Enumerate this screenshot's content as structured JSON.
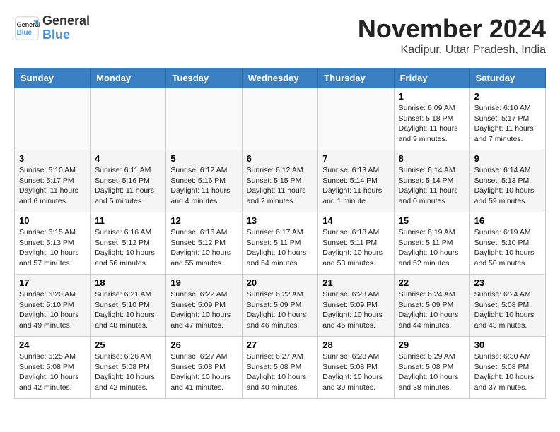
{
  "logo": {
    "general": "General",
    "blue": "Blue"
  },
  "title": "November 2024",
  "subtitle": "Kadipur, Uttar Pradesh, India",
  "days_of_week": [
    "Sunday",
    "Monday",
    "Tuesday",
    "Wednesday",
    "Thursday",
    "Friday",
    "Saturday"
  ],
  "weeks": [
    [
      {
        "day": "",
        "info": ""
      },
      {
        "day": "",
        "info": ""
      },
      {
        "day": "",
        "info": ""
      },
      {
        "day": "",
        "info": ""
      },
      {
        "day": "",
        "info": ""
      },
      {
        "day": "1",
        "info": "Sunrise: 6:09 AM\nSunset: 5:18 PM\nDaylight: 11 hours\nand 9 minutes."
      },
      {
        "day": "2",
        "info": "Sunrise: 6:10 AM\nSunset: 5:17 PM\nDaylight: 11 hours\nand 7 minutes."
      }
    ],
    [
      {
        "day": "3",
        "info": "Sunrise: 6:10 AM\nSunset: 5:17 PM\nDaylight: 11 hours\nand 6 minutes."
      },
      {
        "day": "4",
        "info": "Sunrise: 6:11 AM\nSunset: 5:16 PM\nDaylight: 11 hours\nand 5 minutes."
      },
      {
        "day": "5",
        "info": "Sunrise: 6:12 AM\nSunset: 5:16 PM\nDaylight: 11 hours\nand 4 minutes."
      },
      {
        "day": "6",
        "info": "Sunrise: 6:12 AM\nSunset: 5:15 PM\nDaylight: 11 hours\nand 2 minutes."
      },
      {
        "day": "7",
        "info": "Sunrise: 6:13 AM\nSunset: 5:14 PM\nDaylight: 11 hours\nand 1 minute."
      },
      {
        "day": "8",
        "info": "Sunrise: 6:14 AM\nSunset: 5:14 PM\nDaylight: 11 hours\nand 0 minutes."
      },
      {
        "day": "9",
        "info": "Sunrise: 6:14 AM\nSunset: 5:13 PM\nDaylight: 10 hours\nand 59 minutes."
      }
    ],
    [
      {
        "day": "10",
        "info": "Sunrise: 6:15 AM\nSunset: 5:13 PM\nDaylight: 10 hours\nand 57 minutes."
      },
      {
        "day": "11",
        "info": "Sunrise: 6:16 AM\nSunset: 5:12 PM\nDaylight: 10 hours\nand 56 minutes."
      },
      {
        "day": "12",
        "info": "Sunrise: 6:16 AM\nSunset: 5:12 PM\nDaylight: 10 hours\nand 55 minutes."
      },
      {
        "day": "13",
        "info": "Sunrise: 6:17 AM\nSunset: 5:11 PM\nDaylight: 10 hours\nand 54 minutes."
      },
      {
        "day": "14",
        "info": "Sunrise: 6:18 AM\nSunset: 5:11 PM\nDaylight: 10 hours\nand 53 minutes."
      },
      {
        "day": "15",
        "info": "Sunrise: 6:19 AM\nSunset: 5:11 PM\nDaylight: 10 hours\nand 52 minutes."
      },
      {
        "day": "16",
        "info": "Sunrise: 6:19 AM\nSunset: 5:10 PM\nDaylight: 10 hours\nand 50 minutes."
      }
    ],
    [
      {
        "day": "17",
        "info": "Sunrise: 6:20 AM\nSunset: 5:10 PM\nDaylight: 10 hours\nand 49 minutes."
      },
      {
        "day": "18",
        "info": "Sunrise: 6:21 AM\nSunset: 5:10 PM\nDaylight: 10 hours\nand 48 minutes."
      },
      {
        "day": "19",
        "info": "Sunrise: 6:22 AM\nSunset: 5:09 PM\nDaylight: 10 hours\nand 47 minutes."
      },
      {
        "day": "20",
        "info": "Sunrise: 6:22 AM\nSunset: 5:09 PM\nDaylight: 10 hours\nand 46 minutes."
      },
      {
        "day": "21",
        "info": "Sunrise: 6:23 AM\nSunset: 5:09 PM\nDaylight: 10 hours\nand 45 minutes."
      },
      {
        "day": "22",
        "info": "Sunrise: 6:24 AM\nSunset: 5:09 PM\nDaylight: 10 hours\nand 44 minutes."
      },
      {
        "day": "23",
        "info": "Sunrise: 6:24 AM\nSunset: 5:08 PM\nDaylight: 10 hours\nand 43 minutes."
      }
    ],
    [
      {
        "day": "24",
        "info": "Sunrise: 6:25 AM\nSunset: 5:08 PM\nDaylight: 10 hours\nand 42 minutes."
      },
      {
        "day": "25",
        "info": "Sunrise: 6:26 AM\nSunset: 5:08 PM\nDaylight: 10 hours\nand 42 minutes."
      },
      {
        "day": "26",
        "info": "Sunrise: 6:27 AM\nSunset: 5:08 PM\nDaylight: 10 hours\nand 41 minutes."
      },
      {
        "day": "27",
        "info": "Sunrise: 6:27 AM\nSunset: 5:08 PM\nDaylight: 10 hours\nand 40 minutes."
      },
      {
        "day": "28",
        "info": "Sunrise: 6:28 AM\nSunset: 5:08 PM\nDaylight: 10 hours\nand 39 minutes."
      },
      {
        "day": "29",
        "info": "Sunrise: 6:29 AM\nSunset: 5:08 PM\nDaylight: 10 hours\nand 38 minutes."
      },
      {
        "day": "30",
        "info": "Sunrise: 6:30 AM\nSunset: 5:08 PM\nDaylight: 10 hours\nand 37 minutes."
      }
    ]
  ]
}
